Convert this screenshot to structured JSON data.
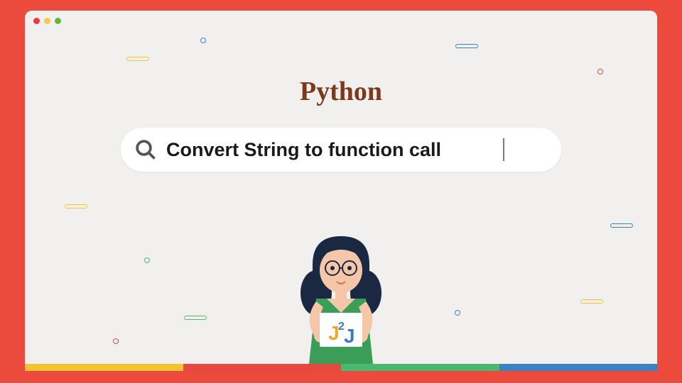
{
  "title": "Python",
  "search": {
    "text": "Convert String to function call"
  },
  "logo": {
    "text_j1": "J",
    "text_2": "2",
    "text_j2": "J"
  },
  "colors": {
    "brand_brown": "#7b3a1c",
    "bg_red": "#eb4a3d",
    "accent_yellow": "#f4c430",
    "accent_green": "#4ab86e",
    "accent_blue": "#3b82c4"
  }
}
